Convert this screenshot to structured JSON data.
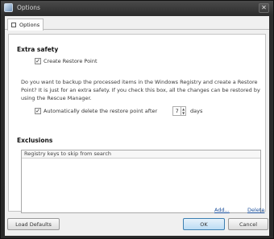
{
  "window": {
    "title": "Options",
    "close_glyph": "✕"
  },
  "tabs": [
    {
      "label": "Options"
    }
  ],
  "extra_safety": {
    "heading": "Extra safety",
    "create_restore_point_label": "Create Restore Point",
    "create_restore_point_checked": true,
    "description": "Do you want to backup the processed items in the Windows Registry and create a Restore Point? It is just for an extra safety. If you check this box, all the changes can be restored by using the Rescue Manager.",
    "auto_delete_label": "Automatically delete the restore point after",
    "auto_delete_checked": true,
    "days_value": "7",
    "days_unit": "days"
  },
  "exclusions": {
    "heading": "Exclusions",
    "column_header": "Registry keys to skip from search",
    "rows": [],
    "add_link": "Add...",
    "delete_link": "Delete"
  },
  "footer": {
    "load_defaults_label": "Load Defaults",
    "ok_label": "OK",
    "cancel_label": "Cancel"
  }
}
